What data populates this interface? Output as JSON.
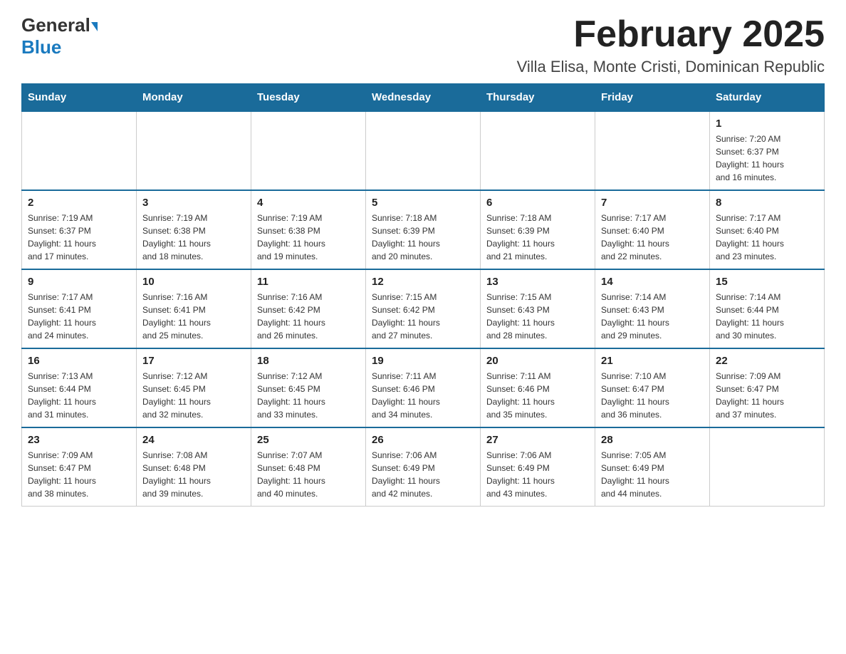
{
  "header": {
    "logo_general": "General",
    "logo_blue": "Blue",
    "month_title": "February 2025",
    "location": "Villa Elisa, Monte Cristi, Dominican Republic"
  },
  "weekdays": [
    "Sunday",
    "Monday",
    "Tuesday",
    "Wednesday",
    "Thursday",
    "Friday",
    "Saturday"
  ],
  "weeks": [
    [
      {
        "day": "",
        "info": ""
      },
      {
        "day": "",
        "info": ""
      },
      {
        "day": "",
        "info": ""
      },
      {
        "day": "",
        "info": ""
      },
      {
        "day": "",
        "info": ""
      },
      {
        "day": "",
        "info": ""
      },
      {
        "day": "1",
        "info": "Sunrise: 7:20 AM\nSunset: 6:37 PM\nDaylight: 11 hours\nand 16 minutes."
      }
    ],
    [
      {
        "day": "2",
        "info": "Sunrise: 7:19 AM\nSunset: 6:37 PM\nDaylight: 11 hours\nand 17 minutes."
      },
      {
        "day": "3",
        "info": "Sunrise: 7:19 AM\nSunset: 6:38 PM\nDaylight: 11 hours\nand 18 minutes."
      },
      {
        "day": "4",
        "info": "Sunrise: 7:19 AM\nSunset: 6:38 PM\nDaylight: 11 hours\nand 19 minutes."
      },
      {
        "day": "5",
        "info": "Sunrise: 7:18 AM\nSunset: 6:39 PM\nDaylight: 11 hours\nand 20 minutes."
      },
      {
        "day": "6",
        "info": "Sunrise: 7:18 AM\nSunset: 6:39 PM\nDaylight: 11 hours\nand 21 minutes."
      },
      {
        "day": "7",
        "info": "Sunrise: 7:17 AM\nSunset: 6:40 PM\nDaylight: 11 hours\nand 22 minutes."
      },
      {
        "day": "8",
        "info": "Sunrise: 7:17 AM\nSunset: 6:40 PM\nDaylight: 11 hours\nand 23 minutes."
      }
    ],
    [
      {
        "day": "9",
        "info": "Sunrise: 7:17 AM\nSunset: 6:41 PM\nDaylight: 11 hours\nand 24 minutes."
      },
      {
        "day": "10",
        "info": "Sunrise: 7:16 AM\nSunset: 6:41 PM\nDaylight: 11 hours\nand 25 minutes."
      },
      {
        "day": "11",
        "info": "Sunrise: 7:16 AM\nSunset: 6:42 PM\nDaylight: 11 hours\nand 26 minutes."
      },
      {
        "day": "12",
        "info": "Sunrise: 7:15 AM\nSunset: 6:42 PM\nDaylight: 11 hours\nand 27 minutes."
      },
      {
        "day": "13",
        "info": "Sunrise: 7:15 AM\nSunset: 6:43 PM\nDaylight: 11 hours\nand 28 minutes."
      },
      {
        "day": "14",
        "info": "Sunrise: 7:14 AM\nSunset: 6:43 PM\nDaylight: 11 hours\nand 29 minutes."
      },
      {
        "day": "15",
        "info": "Sunrise: 7:14 AM\nSunset: 6:44 PM\nDaylight: 11 hours\nand 30 minutes."
      }
    ],
    [
      {
        "day": "16",
        "info": "Sunrise: 7:13 AM\nSunset: 6:44 PM\nDaylight: 11 hours\nand 31 minutes."
      },
      {
        "day": "17",
        "info": "Sunrise: 7:12 AM\nSunset: 6:45 PM\nDaylight: 11 hours\nand 32 minutes."
      },
      {
        "day": "18",
        "info": "Sunrise: 7:12 AM\nSunset: 6:45 PM\nDaylight: 11 hours\nand 33 minutes."
      },
      {
        "day": "19",
        "info": "Sunrise: 7:11 AM\nSunset: 6:46 PM\nDaylight: 11 hours\nand 34 minutes."
      },
      {
        "day": "20",
        "info": "Sunrise: 7:11 AM\nSunset: 6:46 PM\nDaylight: 11 hours\nand 35 minutes."
      },
      {
        "day": "21",
        "info": "Sunrise: 7:10 AM\nSunset: 6:47 PM\nDaylight: 11 hours\nand 36 minutes."
      },
      {
        "day": "22",
        "info": "Sunrise: 7:09 AM\nSunset: 6:47 PM\nDaylight: 11 hours\nand 37 minutes."
      }
    ],
    [
      {
        "day": "23",
        "info": "Sunrise: 7:09 AM\nSunset: 6:47 PM\nDaylight: 11 hours\nand 38 minutes."
      },
      {
        "day": "24",
        "info": "Sunrise: 7:08 AM\nSunset: 6:48 PM\nDaylight: 11 hours\nand 39 minutes."
      },
      {
        "day": "25",
        "info": "Sunrise: 7:07 AM\nSunset: 6:48 PM\nDaylight: 11 hours\nand 40 minutes."
      },
      {
        "day": "26",
        "info": "Sunrise: 7:06 AM\nSunset: 6:49 PM\nDaylight: 11 hours\nand 42 minutes."
      },
      {
        "day": "27",
        "info": "Sunrise: 7:06 AM\nSunset: 6:49 PM\nDaylight: 11 hours\nand 43 minutes."
      },
      {
        "day": "28",
        "info": "Sunrise: 7:05 AM\nSunset: 6:49 PM\nDaylight: 11 hours\nand 44 minutes."
      },
      {
        "day": "",
        "info": ""
      }
    ]
  ]
}
